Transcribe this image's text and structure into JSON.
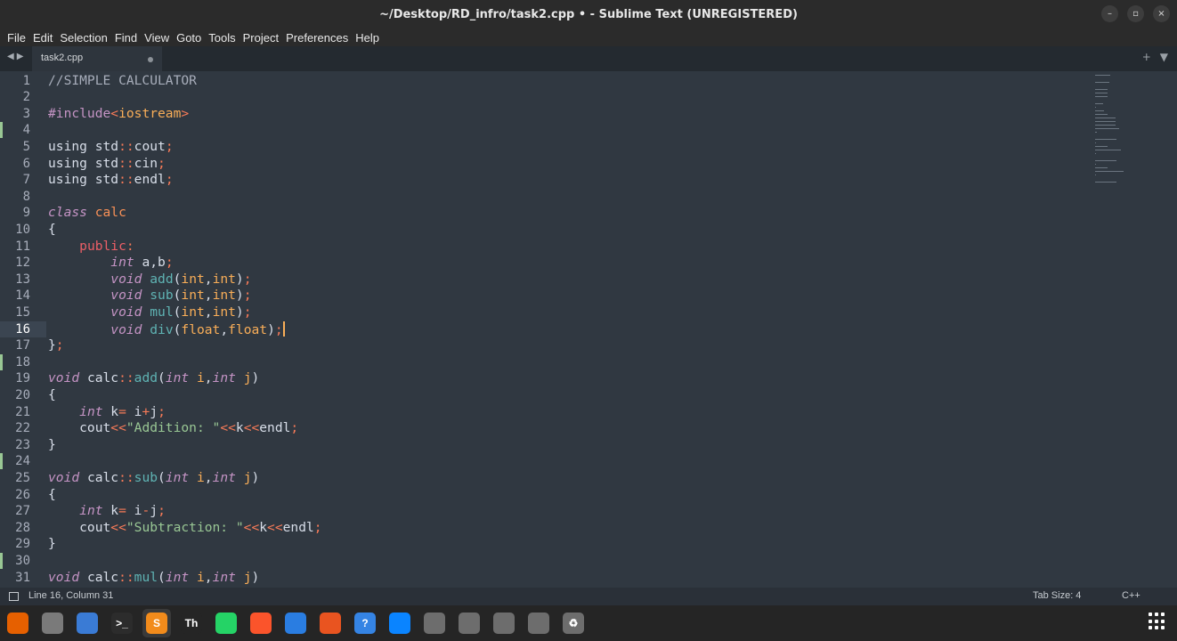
{
  "window": {
    "title": "~/Desktop/RD_infro/task2.cpp • - Sublime Text (UNREGISTERED)"
  },
  "menu": [
    "File",
    "Edit",
    "Selection",
    "Find",
    "View",
    "Goto",
    "Tools",
    "Project",
    "Preferences",
    "Help"
  ],
  "tabs": [
    {
      "label": "task2.cpp",
      "modified": true
    }
  ],
  "editor": {
    "current_line": 16,
    "lines": [
      {
        "n": "1",
        "tokens": [
          [
            "c",
            "//SIMPLE CALCULATOR"
          ]
        ]
      },
      {
        "n": "2",
        "tokens": []
      },
      {
        "n": "3",
        "tokens": [
          [
            "inc",
            "#include"
          ],
          [
            "op",
            "<"
          ],
          [
            "prm",
            "iostream"
          ],
          [
            "op",
            ">"
          ]
        ]
      },
      {
        "n": "4",
        "tokens": [],
        "mark": true
      },
      {
        "n": "5",
        "tokens": [
          [
            "d",
            "using std"
          ],
          [
            "op",
            "::"
          ],
          [
            "d",
            "cout"
          ],
          [
            "op",
            ";"
          ]
        ]
      },
      {
        "n": "6",
        "tokens": [
          [
            "d",
            "using std"
          ],
          [
            "op",
            "::"
          ],
          [
            "d",
            "cin"
          ],
          [
            "op",
            ";"
          ]
        ]
      },
      {
        "n": "7",
        "tokens": [
          [
            "d",
            "using std"
          ],
          [
            "op",
            "::"
          ],
          [
            "d",
            "endl"
          ],
          [
            "op",
            ";"
          ]
        ]
      },
      {
        "n": "8",
        "tokens": []
      },
      {
        "n": "9",
        "tokens": [
          [
            "k",
            "class"
          ],
          [
            "d",
            " "
          ],
          [
            "cls",
            "calc"
          ]
        ]
      },
      {
        "n": "10",
        "tokens": [
          [
            "d",
            "{"
          ]
        ]
      },
      {
        "n": "11",
        "tokens": [
          [
            "d",
            "    "
          ],
          [
            "p",
            "public"
          ],
          [
            "op",
            ":"
          ]
        ]
      },
      {
        "n": "12",
        "tokens": [
          [
            "d",
            "        "
          ],
          [
            "t",
            "int"
          ],
          [
            "d",
            " a,b"
          ],
          [
            "op",
            ";"
          ]
        ]
      },
      {
        "n": "13",
        "tokens": [
          [
            "d",
            "        "
          ],
          [
            "t",
            "void"
          ],
          [
            "d",
            " "
          ],
          [
            "fn",
            "add"
          ],
          [
            "d",
            "("
          ],
          [
            "prm",
            "int"
          ],
          [
            "d",
            ","
          ],
          [
            "prm",
            "int"
          ],
          [
            "d",
            ")"
          ],
          [
            "op",
            ";"
          ]
        ]
      },
      {
        "n": "14",
        "tokens": [
          [
            "d",
            "        "
          ],
          [
            "t",
            "void"
          ],
          [
            "d",
            " "
          ],
          [
            "fn",
            "sub"
          ],
          [
            "d",
            "("
          ],
          [
            "prm",
            "int"
          ],
          [
            "d",
            ","
          ],
          [
            "prm",
            "int"
          ],
          [
            "d",
            ")"
          ],
          [
            "op",
            ";"
          ]
        ]
      },
      {
        "n": "15",
        "tokens": [
          [
            "d",
            "        "
          ],
          [
            "t",
            "void"
          ],
          [
            "d",
            " "
          ],
          [
            "fn",
            "mul"
          ],
          [
            "d",
            "("
          ],
          [
            "prm",
            "int"
          ],
          [
            "d",
            ","
          ],
          [
            "prm",
            "int"
          ],
          [
            "d",
            ")"
          ],
          [
            "op",
            ";"
          ]
        ]
      },
      {
        "n": "16",
        "tokens": [
          [
            "d",
            "        "
          ],
          [
            "t",
            "void"
          ],
          [
            "d",
            " "
          ],
          [
            "fn",
            "div"
          ],
          [
            "d",
            "("
          ],
          [
            "prm",
            "float"
          ],
          [
            "d",
            ","
          ],
          [
            "prm",
            "float"
          ],
          [
            "d",
            ")"
          ],
          [
            "op",
            ";"
          ]
        ]
      },
      {
        "n": "17",
        "tokens": [
          [
            "d",
            "}"
          ],
          [
            "op",
            ";"
          ]
        ]
      },
      {
        "n": "18",
        "tokens": [],
        "mark": true
      },
      {
        "n": "19",
        "tokens": [
          [
            "t",
            "void"
          ],
          [
            "d",
            " calc"
          ],
          [
            "op",
            "::"
          ],
          [
            "fn",
            "add"
          ],
          [
            "d",
            "("
          ],
          [
            "t",
            "int"
          ],
          [
            "d",
            " "
          ],
          [
            "prm",
            "i"
          ],
          [
            "d",
            ","
          ],
          [
            "t",
            "int"
          ],
          [
            "d",
            " "
          ],
          [
            "prm",
            "j"
          ],
          [
            "d",
            ")"
          ]
        ]
      },
      {
        "n": "20",
        "tokens": [
          [
            "d",
            "{"
          ]
        ]
      },
      {
        "n": "21",
        "tokens": [
          [
            "d",
            "    "
          ],
          [
            "t",
            "int"
          ],
          [
            "d",
            " k"
          ],
          [
            "op",
            "="
          ],
          [
            "d",
            " i"
          ],
          [
            "op",
            "+"
          ],
          [
            "d",
            "j"
          ],
          [
            "op",
            ";"
          ]
        ]
      },
      {
        "n": "22",
        "tokens": [
          [
            "d",
            "    cout"
          ],
          [
            "op",
            "<<"
          ],
          [
            "s",
            "\"Addition: \""
          ],
          [
            "op",
            "<<"
          ],
          [
            "d",
            "k"
          ],
          [
            "op",
            "<<"
          ],
          [
            "d",
            "endl"
          ],
          [
            "op",
            ";"
          ]
        ]
      },
      {
        "n": "23",
        "tokens": [
          [
            "d",
            "}"
          ]
        ]
      },
      {
        "n": "24",
        "tokens": [],
        "mark": true
      },
      {
        "n": "25",
        "tokens": [
          [
            "t",
            "void"
          ],
          [
            "d",
            " calc"
          ],
          [
            "op",
            "::"
          ],
          [
            "fn",
            "sub"
          ],
          [
            "d",
            "("
          ],
          [
            "t",
            "int"
          ],
          [
            "d",
            " "
          ],
          [
            "prm",
            "i"
          ],
          [
            "d",
            ","
          ],
          [
            "t",
            "int"
          ],
          [
            "d",
            " "
          ],
          [
            "prm",
            "j"
          ],
          [
            "d",
            ")"
          ]
        ]
      },
      {
        "n": "26",
        "tokens": [
          [
            "d",
            "{"
          ]
        ]
      },
      {
        "n": "27",
        "tokens": [
          [
            "d",
            "    "
          ],
          [
            "t",
            "int"
          ],
          [
            "d",
            " k"
          ],
          [
            "op",
            "="
          ],
          [
            "d",
            " i"
          ],
          [
            "op",
            "-"
          ],
          [
            "d",
            "j"
          ],
          [
            "op",
            ";"
          ]
        ]
      },
      {
        "n": "28",
        "tokens": [
          [
            "d",
            "    cout"
          ],
          [
            "op",
            "<<"
          ],
          [
            "s",
            "\"Subtraction: \""
          ],
          [
            "op",
            "<<"
          ],
          [
            "d",
            "k"
          ],
          [
            "op",
            "<<"
          ],
          [
            "d",
            "endl"
          ],
          [
            "op",
            ";"
          ]
        ]
      },
      {
        "n": "29",
        "tokens": [
          [
            "d",
            "}"
          ]
        ]
      },
      {
        "n": "30",
        "tokens": [],
        "mark": true
      },
      {
        "n": "31",
        "tokens": [
          [
            "t",
            "void"
          ],
          [
            "d",
            " calc"
          ],
          [
            "op",
            "::"
          ],
          [
            "fn",
            "mul"
          ],
          [
            "d",
            "("
          ],
          [
            "t",
            "int"
          ],
          [
            "d",
            " "
          ],
          [
            "prm",
            "i"
          ],
          [
            "d",
            ","
          ],
          [
            "t",
            "int"
          ],
          [
            "d",
            " "
          ],
          [
            "prm",
            "j"
          ],
          [
            "d",
            ")"
          ]
        ]
      }
    ]
  },
  "status": {
    "position": "Line 16, Column 31",
    "tab_size": "Tab Size: 4",
    "syntax": "C++"
  },
  "dock": [
    {
      "name": "firefox-icon",
      "color": "#e66000",
      "glyph": ""
    },
    {
      "name": "files-icon",
      "color": "#7a7a7a",
      "glyph": ""
    },
    {
      "name": "text-editor-icon",
      "color": "#3a7bd5",
      "glyph": ""
    },
    {
      "name": "terminal-icon",
      "color": "#2c2c2c",
      "glyph": ">_"
    },
    {
      "name": "sublime-text-icon",
      "color": "#f28b1b",
      "glyph": "S",
      "active": true
    },
    {
      "name": "typora-icon",
      "color": "#252525",
      "glyph": "Th"
    },
    {
      "name": "whatsapp-icon",
      "color": "#25d366",
      "glyph": ""
    },
    {
      "name": "brave-icon",
      "color": "#fb542b",
      "glyph": ""
    },
    {
      "name": "document-viewer-icon",
      "color": "#2a7de1",
      "glyph": ""
    },
    {
      "name": "software-center-icon",
      "color": "#e95420",
      "glyph": ""
    },
    {
      "name": "help-icon",
      "color": "#3584e4",
      "glyph": "?"
    },
    {
      "name": "thunderbird-icon",
      "color": "#0a84ff",
      "glyph": ""
    },
    {
      "name": "drive-icon-1",
      "color": "#6d6d6d",
      "glyph": ""
    },
    {
      "name": "drive-icon-2",
      "color": "#6d6d6d",
      "glyph": ""
    },
    {
      "name": "drive-icon-3",
      "color": "#6d6d6d",
      "glyph": ""
    },
    {
      "name": "drive-icon-4",
      "color": "#6d6d6d",
      "glyph": ""
    },
    {
      "name": "trash-icon",
      "color": "#6d6d6d",
      "glyph": "♻"
    }
  ]
}
